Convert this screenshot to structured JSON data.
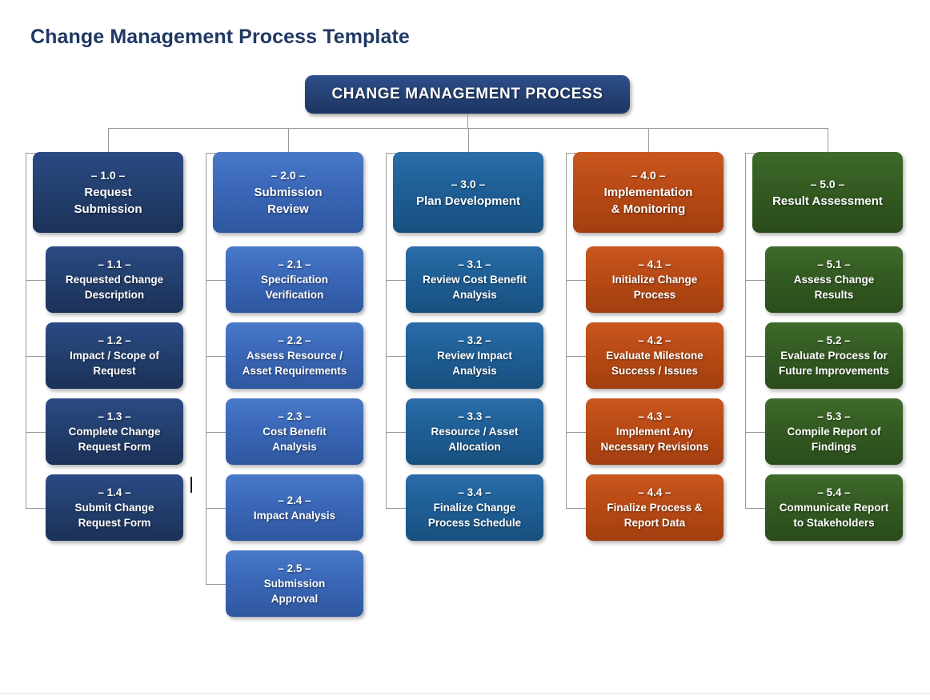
{
  "page": {
    "title": "Change Management Process Template",
    "title_color": "#1f3864",
    "background": "#ffffff",
    "connector_color": "#9a9a9a"
  },
  "root": {
    "label": "CHANGE MANAGEMENT PROCESS",
    "color": "#264478"
  },
  "columns": [
    {
      "id": "column-1",
      "color": "#24406f",
      "head": {
        "num": "– 1.0 –",
        "line1": "Request",
        "line2": "Submission"
      },
      "children": [
        {
          "num": "– 1.1 –",
          "line1": "Requested Change",
          "line2": "Description"
        },
        {
          "num": "– 1.2 –",
          "line1": "Impact / Scope of",
          "line2": "Request"
        },
        {
          "num": "– 1.3 –",
          "line1": "Complete Change",
          "line2": "Request Form"
        },
        {
          "num": "– 1.4 –",
          "line1": "Submit Change",
          "line2": "Request Form"
        }
      ]
    },
    {
      "id": "column-2",
      "color": "#3a67b7",
      "head": {
        "num": "– 2.0 –",
        "line1": "Submission",
        "line2": "Review"
      },
      "children": [
        {
          "num": "– 2.1 –",
          "line1": "Specification",
          "line2": "Verification"
        },
        {
          "num": "– 2.2 –",
          "line1": "Assess Resource /",
          "line2": "Asset Requirements"
        },
        {
          "num": "– 2.3 –",
          "line1": "Cost Benefit",
          "line2": "Analysis"
        },
        {
          "num": "– 2.4 –",
          "line1": "Impact Analysis",
          "line2": ""
        },
        {
          "num": "– 2.5 –",
          "line1": "Submission",
          "line2": "Approval"
        }
      ]
    },
    {
      "id": "column-3",
      "color": "#1f5f96",
      "head": {
        "num": "– 3.0 –",
        "line1": "Plan Development",
        "line2": ""
      },
      "children": [
        {
          "num": "– 3.1 –",
          "line1": "Review Cost Benefit",
          "line2": "Analysis"
        },
        {
          "num": "– 3.2 –",
          "line1": "Review Impact",
          "line2": "Analysis"
        },
        {
          "num": "– 3.3 –",
          "line1": "Resource / Asset",
          "line2": "Allocation"
        },
        {
          "num": "– 3.4 –",
          "line1": "Finalize Change",
          "line2": "Process Schedule"
        }
      ]
    },
    {
      "id": "column-4",
      "color": "#b94a15",
      "head": {
        "num": "– 4.0 –",
        "line1": "Implementation",
        "line2": "& Monitoring"
      },
      "children": [
        {
          "num": "– 4.1 –",
          "line1": "Initialize Change",
          "line2": "Process"
        },
        {
          "num": "– 4.2 –",
          "line1": "Evaluate Milestone",
          "line2": "Success / Issues"
        },
        {
          "num": "– 4.3 –",
          "line1": "Implement Any",
          "line2": "Necessary Revisions"
        },
        {
          "num": "– 4.4 –",
          "line1": "Finalize Process &",
          "line2": "Report Data"
        }
      ]
    },
    {
      "id": "column-5",
      "color": "#345b22",
      "head": {
        "num": "– 5.0 –",
        "line1": "Result Assessment",
        "line2": ""
      },
      "children": [
        {
          "num": "– 5.1 –",
          "line1": "Assess Change",
          "line2": "Results"
        },
        {
          "num": "– 5.2 –",
          "line1": "Evaluate Process for",
          "line2": "Future Improvements"
        },
        {
          "num": "– 5.3 –",
          "line1": "Compile Report of",
          "line2": "Findings"
        },
        {
          "num": "– 5.4 –",
          "line1": "Communicate Report",
          "line2": "to Stakeholders"
        }
      ]
    }
  ]
}
